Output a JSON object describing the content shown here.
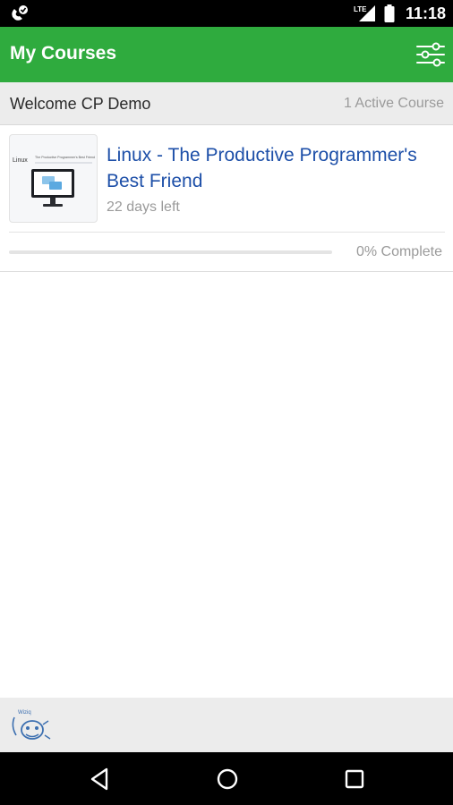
{
  "status_bar": {
    "network": "LTE",
    "time": "11:18",
    "icons": [
      "call-notification-icon",
      "signal-icon",
      "battery-icon"
    ]
  },
  "app_bar": {
    "title": "My Courses",
    "menu_icon": "settings-sliders-icon",
    "background": "#2fab3e"
  },
  "welcome": {
    "greeting": "Welcome CP Demo",
    "active_count": "1 Active Course"
  },
  "courses": [
    {
      "title": "Linux - The Productive Programmer's Best Friend",
      "days_left": "22 days left",
      "progress_text": "0% Complete",
      "progress_value": 0,
      "thumbnail": {
        "label": "Linux",
        "caption": "The Productive Programmer's Best Friend",
        "icon": "computer-monitor-icon"
      }
    }
  ],
  "footer": {
    "logo_text": "Wiziq",
    "logo_icon": "brand-logo-icon"
  },
  "nav_bar": {
    "icons": [
      "back-icon",
      "home-icon",
      "recent-apps-icon"
    ]
  },
  "colors": {
    "accent": "#2fab3e",
    "link": "#1d4fa8",
    "muted_text": "#9a9a9a",
    "header_background": "#ececec"
  }
}
